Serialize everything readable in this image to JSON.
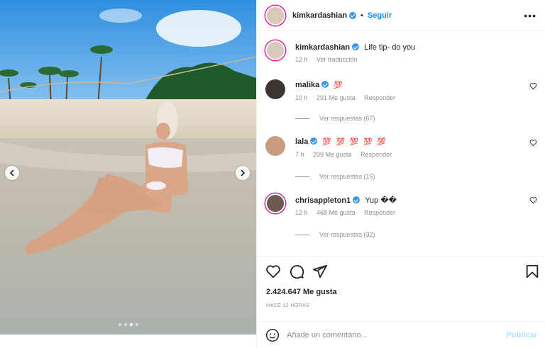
{
  "post": {
    "author": "kimkardashian",
    "follow_label": "Seguir",
    "separator": "•",
    "caption": "Life tip- do you",
    "caption_time": "12 h",
    "translate_label": "Ver traducción",
    "likes": "2.424.647 Me gusta",
    "posted_ago": "HACE 12 HORAS",
    "carousel_dots": 4,
    "carousel_active": 3
  },
  "comments": [
    {
      "user": "malika",
      "text": "💯",
      "time": "10 h",
      "likes": "291 Me gusta",
      "reply": "Responder",
      "replies": "Ver respuestas (67)"
    },
    {
      "user": "lala",
      "text": "💯 💯 💯 💯 💯",
      "time": "7 h",
      "likes": "209 Me gusta",
      "reply": "Responder",
      "replies": "Ver respuestas (15)"
    },
    {
      "user": "chrisappleton1",
      "text": "Yup ��",
      "time": "12 h",
      "likes": "468 Me gusta",
      "reply": "Responder",
      "replies": "Ver respuestas (32)"
    }
  ],
  "composer": {
    "placeholder": "Añade un comentario...",
    "publish_label": "Publicar"
  },
  "icons": [
    "chevron-left-icon",
    "chevron-right-icon",
    "more-icon",
    "heart-icon",
    "comment-icon",
    "share-icon",
    "bookmark-icon",
    "emoji-icon",
    "verified-icon"
  ],
  "colors": {
    "link": "#0095f6",
    "verified": "#3897f0",
    "muted": "#8e8e8e",
    "publish_disabled": "#b2dffc"
  }
}
